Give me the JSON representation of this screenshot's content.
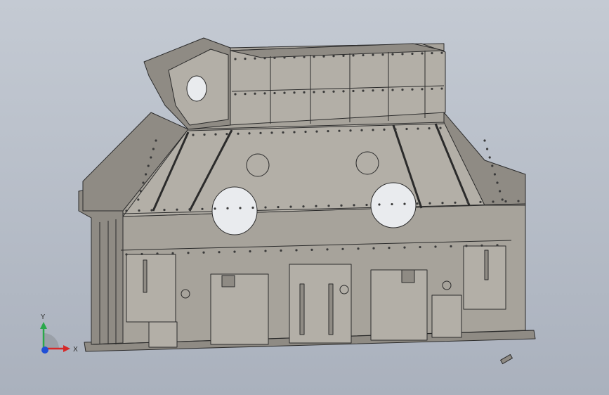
{
  "viewport": {
    "background_top": "#c4cad3",
    "background_bottom": "#aab1bd"
  },
  "model": {
    "body_color": "#a7a39b",
    "panel_color": "#b3afa7",
    "shadow_color": "#8f8b84",
    "edge_color": "#2b2b2b",
    "bolt_color": "#3a3a3a",
    "bore_color": "#e9ebee",
    "icon": "crusher-frame-3d-model"
  },
  "triad": {
    "x_label": "X",
    "y_label": "Y",
    "x_color": "#d62828",
    "y_color": "#2aa84a",
    "z_color": "#1f4fd6"
  },
  "cursor": {
    "icon": "mouse-pointer-icon"
  }
}
